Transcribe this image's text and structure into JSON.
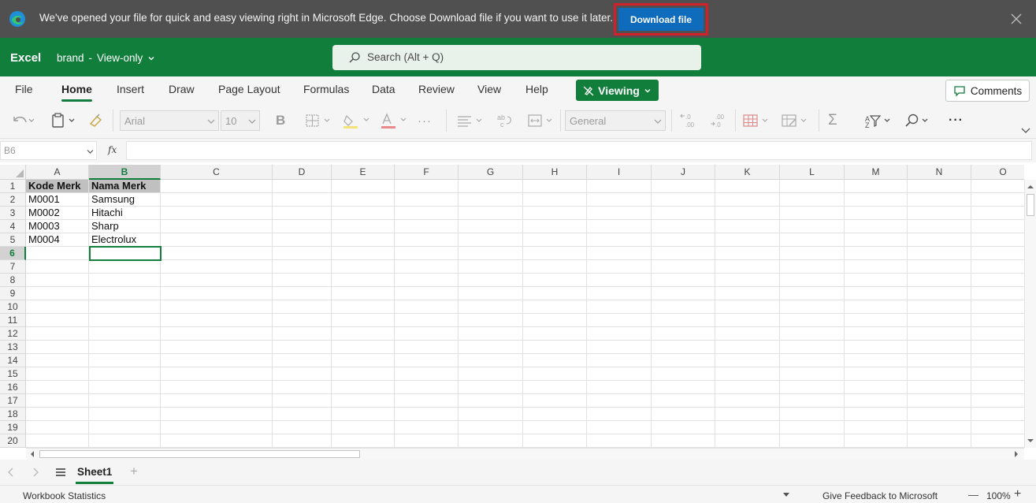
{
  "edge_bar": {
    "message": "We've opened your file for quick and easy viewing right in Microsoft Edge. Choose Download file if you want to use it later.",
    "download_label": "Download file"
  },
  "app": {
    "name": "Excel",
    "doc_name": "brand",
    "separator": "-",
    "mode": "View-only",
    "search_placeholder": "Search (Alt + Q)"
  },
  "ribbon_tabs": [
    {
      "label": "File"
    },
    {
      "label": "Home"
    },
    {
      "label": "Insert"
    },
    {
      "label": "Draw"
    },
    {
      "label": "Page Layout"
    },
    {
      "label": "Formulas"
    },
    {
      "label": "Data"
    },
    {
      "label": "Review"
    },
    {
      "label": "View"
    },
    {
      "label": "Help"
    }
  ],
  "active_tab": "Home",
  "viewing_label": "Viewing",
  "comments_label": "Comments",
  "toolbar": {
    "font_name": "Arial",
    "font_size": "10",
    "number_format": "General",
    "bold_glyph": "B",
    "sigma_glyph": "Σ",
    "more_glyph": "···"
  },
  "formula_bar": {
    "cell_ref": "B6",
    "fx": "fx",
    "value": ""
  },
  "sheet": {
    "columns": [
      "A",
      "B",
      "C",
      "D",
      "E",
      "F",
      "G",
      "H",
      "I",
      "J",
      "K",
      "L",
      "M",
      "N",
      "O"
    ],
    "rows": [
      "1",
      "2",
      "3",
      "4",
      "5",
      "6",
      "7",
      "8",
      "9",
      "10",
      "11",
      "12",
      "13",
      "14",
      "15",
      "16",
      "17",
      "18",
      "19",
      "20"
    ],
    "selected_column": "B",
    "selected_row": "6",
    "cells": [
      {
        "ref": "A1",
        "value": "Kode Merk",
        "header": true
      },
      {
        "ref": "B1",
        "value": "Nama Merk",
        "header": true
      },
      {
        "ref": "A2",
        "value": "M0001"
      },
      {
        "ref": "B2",
        "value": "Samsung"
      },
      {
        "ref": "A3",
        "value": "M0002"
      },
      {
        "ref": "B3",
        "value": "Hitachi"
      },
      {
        "ref": "A4",
        "value": "M0003"
      },
      {
        "ref": "B4",
        "value": "Sharp"
      },
      {
        "ref": "A5",
        "value": "M0004"
      },
      {
        "ref": "B5",
        "value": "Electrolux"
      }
    ]
  },
  "sheet_tabs": [
    {
      "label": "Sheet1"
    }
  ],
  "add_sheet_glyph": "+",
  "status": {
    "stats": "Workbook Statistics",
    "feedback": "Give Feedback to Microsoft",
    "zoom": "100%",
    "zoom_out": "—",
    "zoom_in": "+"
  },
  "colors": {
    "excel_green": "#117e3c",
    "edge_bar": "#505050",
    "download_blue": "#0f6cbd",
    "highlight_red": "#d0202a",
    "header_fill": "#c0c0c0"
  }
}
